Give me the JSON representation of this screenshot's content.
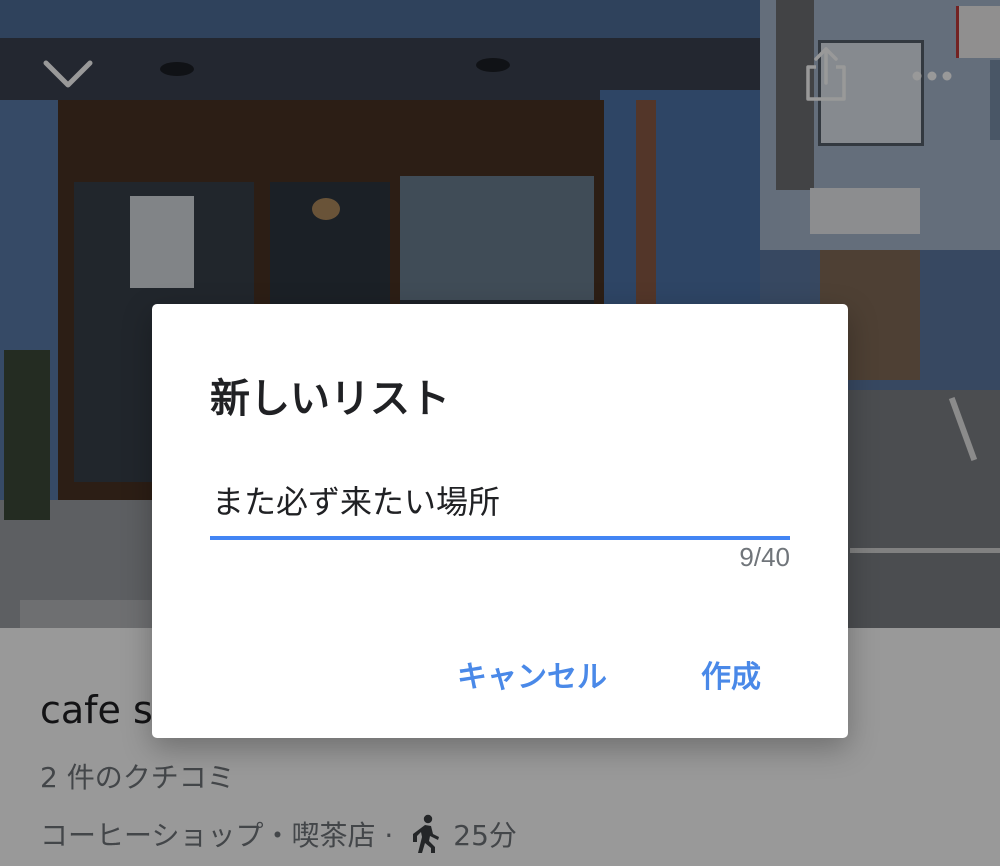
{
  "header": {
    "collapse_icon": "chevron-down-icon",
    "share_icon": "share-icon",
    "more_icon": "more-horizontal-icon"
  },
  "place": {
    "name": "cafe s",
    "reviews": "2 件のクチコミ",
    "category": "コーヒーショップ・喫茶店 ·",
    "walk_icon": "walking-person-icon",
    "walk_time": "25分"
  },
  "dialog": {
    "title": "新しいリスト",
    "input_value": "また必ず来たい場所",
    "counter": "9/40",
    "cancel_label": "キャンセル",
    "create_label": "作成"
  },
  "colors": {
    "accent": "#4285f4",
    "button_text": "#4a89e8",
    "title_text": "#202124",
    "secondary_text": "#70757a"
  }
}
